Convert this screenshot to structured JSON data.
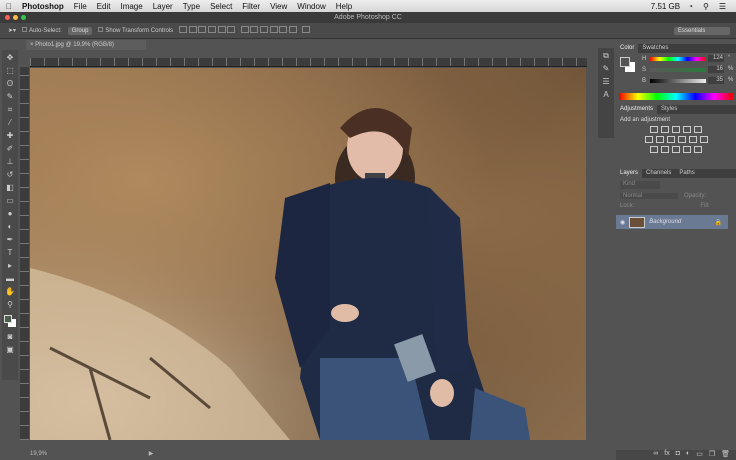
{
  "menubar": {
    "items": [
      "Photoshop",
      "File",
      "Edit",
      "Image",
      "Layer",
      "Type",
      "Select",
      "Filter",
      "View",
      "Window",
      "Help"
    ],
    "memory": "7.51 GB"
  },
  "window": {
    "title": "Adobe Photoshop CC"
  },
  "options": {
    "auto_select": "Auto-Select:",
    "group": "Group",
    "show_transform": "Show Transform Controls",
    "workspace": "Essentials"
  },
  "document": {
    "tab": "Photo1.jpg @ 19,9% (RGB/8)",
    "zoom": "19,9%"
  },
  "color_panel": {
    "tabs": [
      "Color",
      "Swatches"
    ],
    "h_label": "H",
    "s_label": "S",
    "b_label": "B",
    "h": "124",
    "s": "16",
    "b": "35",
    "pct": "%",
    "deg": "°"
  },
  "adjust_panel": {
    "tabs": [
      "Adjustments",
      "Styles"
    ],
    "heading": "Add an adjustment"
  },
  "layers_panel": {
    "tabs": [
      "Layers",
      "Channels",
      "Paths"
    ],
    "kind": "Kind",
    "blend": "Normal",
    "opacity_label": "Opacity:",
    "lock_label": "Lock:",
    "fill_label": "Fill:",
    "layer_name": "Background"
  },
  "colors": {
    "accent": "#6a7a92"
  }
}
